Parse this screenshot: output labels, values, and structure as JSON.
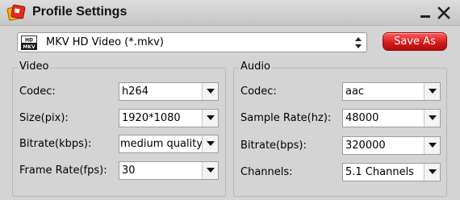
{
  "window": {
    "title": "Profile Settings",
    "minimize_icon": "minimize-icon",
    "close_icon": "close-icon"
  },
  "profile": {
    "icon": "mkv-format-icon",
    "icon_text": "MKV",
    "selected": "MKV HD Video (*.mkv)"
  },
  "save_as_label": "Save As",
  "video": {
    "title": "Video",
    "fields": [
      {
        "label": "Codec:",
        "value": "h264"
      },
      {
        "label": "Size(pix):",
        "value": "1920*1080"
      },
      {
        "label": "Bitrate(kbps):",
        "value": "medium quality"
      },
      {
        "label": "Frame Rate(fps):",
        "value": "30"
      }
    ]
  },
  "audio": {
    "title": "Audio",
    "fields": [
      {
        "label": "Codec:",
        "value": "aac"
      },
      {
        "label": "Sample Rate(hz):",
        "value": "48000"
      },
      {
        "label": "Bitrate(bps):",
        "value": "320000"
      },
      {
        "label": "Channels:",
        "value": "5.1 Channels"
      }
    ]
  },
  "colors": {
    "save_button": "#d81c1c",
    "background": "#d4d4d4"
  }
}
